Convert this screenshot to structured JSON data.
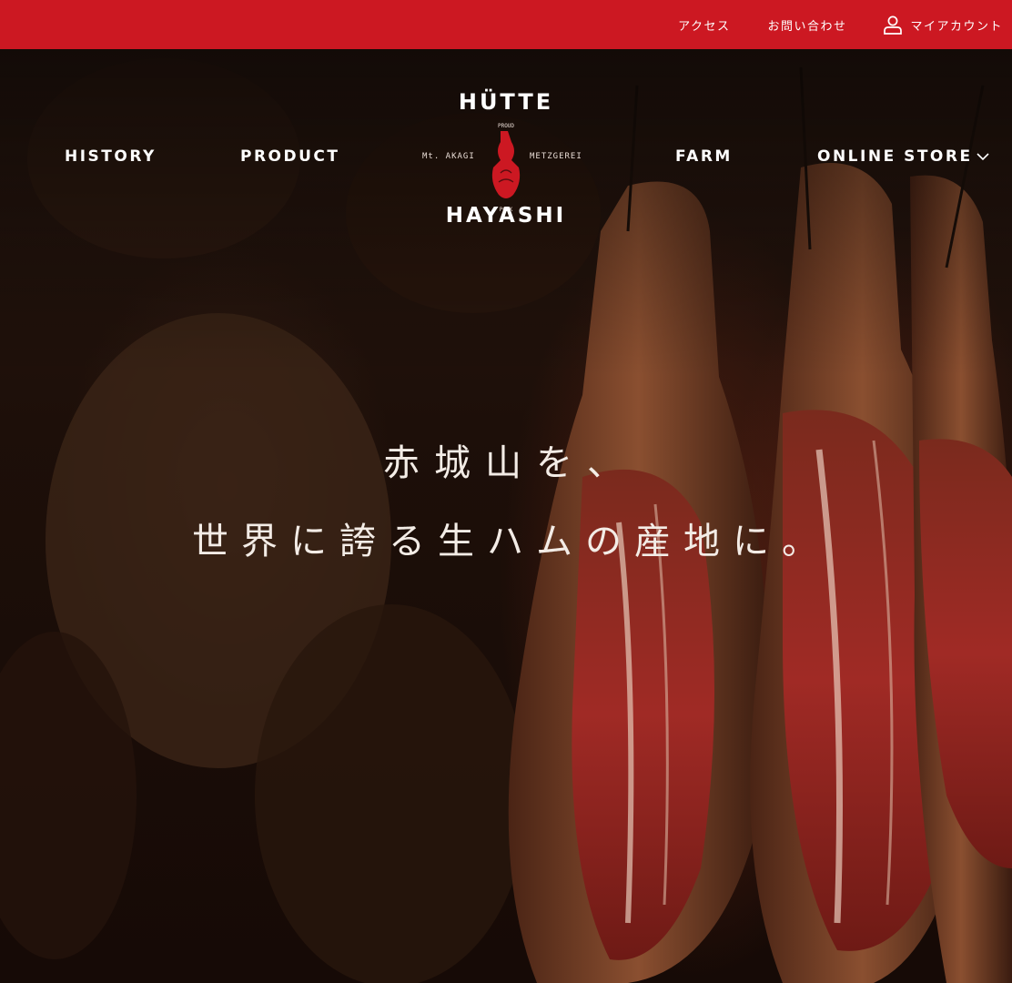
{
  "topbar": {
    "access_label": "アクセス",
    "contact_label": "お問い合わせ",
    "account_label": "マイアカウント",
    "background_color": "#cc1822",
    "account_icon": "user-icon"
  },
  "nav": {
    "history_label": "HISTORY",
    "product_label": "PRODUCT",
    "farm_label": "FARM",
    "online_store_label": "ONLINE STORE",
    "dropdown_icon": "chevron-down-icon"
  },
  "logo": {
    "top_text": "HÜTTE",
    "bottom_text": "HAYASHI",
    "left_text": "Mt. AKAGI",
    "right_text": "METZGEREI",
    "small_top": "PROUD",
    "small_bottom": "PORK",
    "accent_color": "#cc1822"
  },
  "hero": {
    "tagline_line1": "赤城山を、",
    "tagline_line2": "世界に誇る生ハムの産地に。"
  }
}
